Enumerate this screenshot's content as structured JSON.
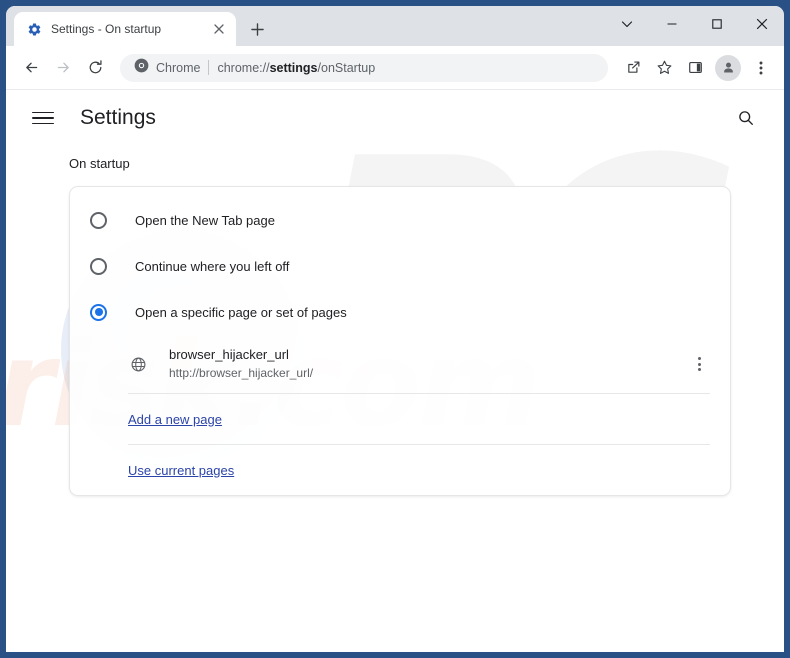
{
  "window": {
    "controls": [
      {
        "name": "chevron-down",
        "label": "⌄"
      },
      {
        "name": "minimize",
        "label": "─"
      },
      {
        "name": "maximize",
        "label": "□"
      },
      {
        "name": "close",
        "label": "✕"
      }
    ]
  },
  "tabstrip": {
    "tab": {
      "title": "Settings - On startup",
      "favicon": "settings-gear-icon",
      "close_label": "✕"
    },
    "new_tab_label": "+"
  },
  "toolbar": {
    "back_label": "←",
    "forward_label": "→",
    "reload_label": "↻",
    "omnibox": {
      "chip_label": "Chrome",
      "url_prefix": "chrome://",
      "url_bold": "settings",
      "url_suffix": "/onStartup"
    },
    "share_icon": "share-icon",
    "bookmark_icon": "star-icon",
    "side_panel_icon": "side-panel-icon",
    "profile_icon": "profile-avatar-icon",
    "menu_label": "⋮"
  },
  "settings": {
    "title": "Settings",
    "menu_icon": "hamburger-menu-icon",
    "search_icon": "search-icon"
  },
  "section": {
    "label": "On startup",
    "options": [
      {
        "label": "Open the New Tab page",
        "checked": false
      },
      {
        "label": "Continue where you left off",
        "checked": false
      },
      {
        "label": "Open a specific page or set of pages",
        "checked": true
      }
    ],
    "startup_pages": [
      {
        "name": "browser_hijacker_url",
        "url": "http://browser_hijacker_url/",
        "icon": "globe-icon",
        "menu_label": "more-actions-icon"
      }
    ],
    "add_page_link": "Add a new page",
    "use_current_link": "Use current pages"
  },
  "watermark": {
    "logo_text": "PC",
    "site_text": "risk.com"
  },
  "colors": {
    "accent": "#1a73e8",
    "link": "#2b44a8",
    "frame": "#2a5186",
    "tabstrip": "#dee1e6"
  }
}
